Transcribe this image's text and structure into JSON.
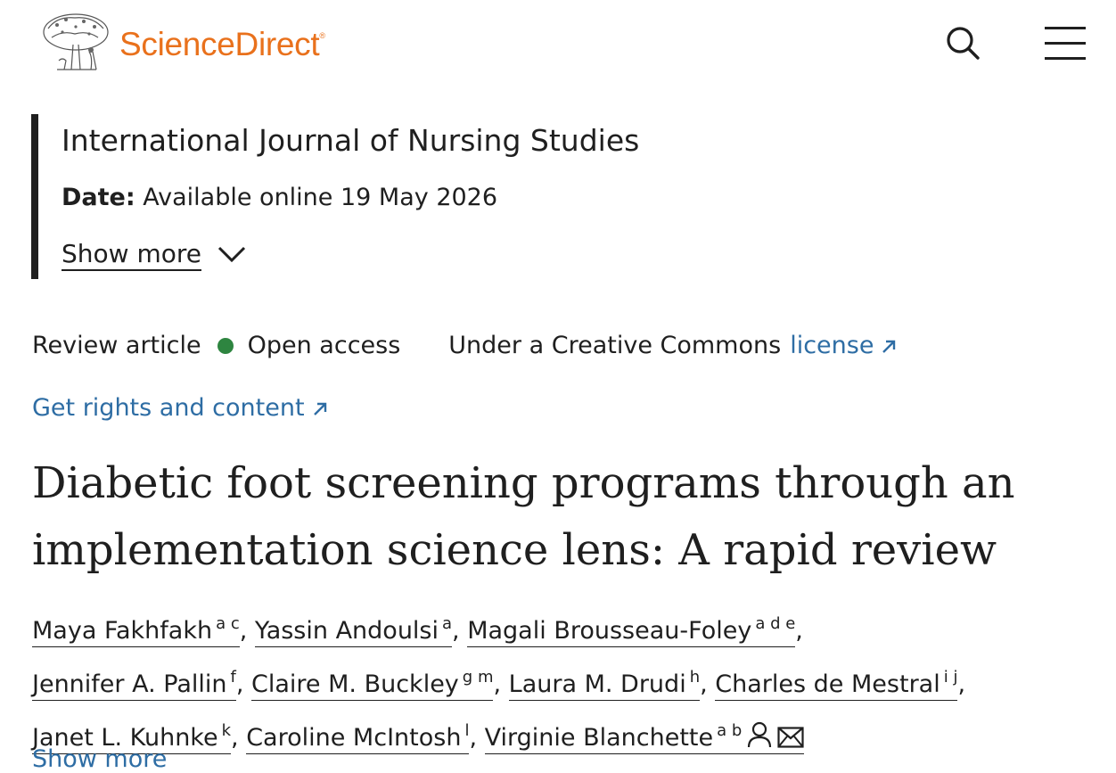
{
  "header": {
    "brand": "ScienceDirect",
    "brand_mark": "®",
    "icons": {
      "search": "search-icon",
      "menu": "hamburger-menu-icon"
    }
  },
  "publication": {
    "journal": "International Journal of Nursing Studies",
    "date_label": "Date:",
    "date_value": "Available online 19 May 2026",
    "show_more": "Show more"
  },
  "article_meta": {
    "type": "Review article",
    "access": "Open access",
    "license_prefix": "Under a Creative Commons",
    "license_link": "license",
    "access_dot_color": "#2e8540"
  },
  "rights": {
    "label": "Get rights and content"
  },
  "title": {
    "line1": "Diabetic foot screening programs through an",
    "line2": "implementation science lens: A rapid review"
  },
  "authors": [
    {
      "name": "Maya Fakhfakh",
      "aff": "a c"
    },
    {
      "name": "Yassin Andoulsi",
      "aff": "a"
    },
    {
      "name": "Magali Brousseau-Foley",
      "aff": "a d e"
    },
    {
      "name": "Jennifer A. Pallin",
      "aff": "f"
    },
    {
      "name": "Claire M. Buckley",
      "aff": "g m"
    },
    {
      "name": "Laura M. Drudi",
      "aff": "h"
    },
    {
      "name": "Charles de Mestral",
      "aff": "i j"
    },
    {
      "name": "Janet L. Kuhnke",
      "aff": "k"
    },
    {
      "name": "Caroline McIntosh",
      "aff": "l"
    },
    {
      "name": "Virginie Blanchette",
      "aff": "a b"
    }
  ],
  "authors_more": {
    "label": "Show more"
  },
  "colors": {
    "brand": "#e9711c",
    "link": "#2e6da4",
    "text": "#1f1f1f"
  }
}
